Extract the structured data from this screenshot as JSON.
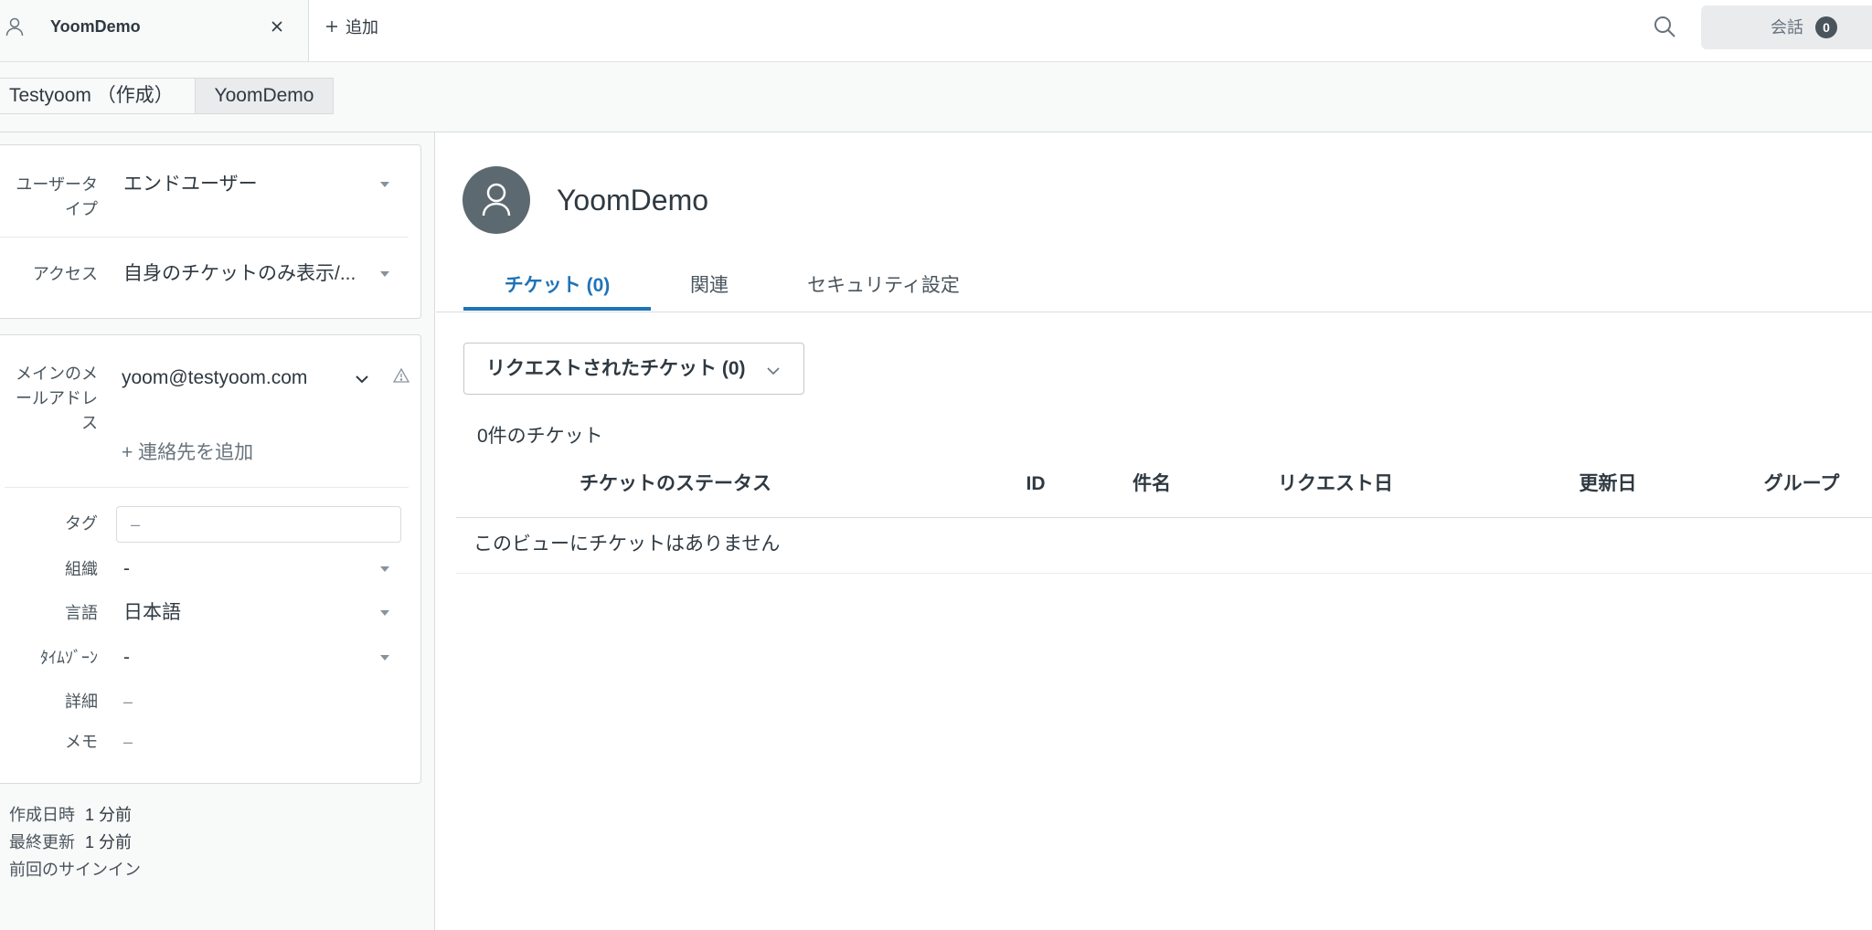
{
  "topbar": {
    "tab_label": "YoomDemo",
    "add_label": "追加",
    "conversations_label": "会話",
    "conversations_count": "0",
    "icons": {
      "tab": "person-icon",
      "close": "close-icon",
      "add": "plus-icon",
      "search": "search-icon"
    }
  },
  "breadcrumb": {
    "items": [
      {
        "label": "Testyoom （作成）",
        "selected": false
      },
      {
        "label": "YoomDemo",
        "selected": true
      }
    ]
  },
  "user_panel": {
    "user_type": {
      "label": "ユーザータイプ",
      "value": "エンドユーザー"
    },
    "access": {
      "label": "アクセス",
      "value": "自身のチケットのみ表示/..."
    },
    "email": {
      "label": "メインのメールアドレス",
      "value": "yoom@testyoom.com"
    },
    "add_contact": "+ 連絡先を追加",
    "tags": {
      "label": "タグ",
      "placeholder": "–"
    },
    "organization": {
      "label": "組織",
      "value": "-"
    },
    "language": {
      "label": "言語",
      "value": "日本語"
    },
    "timezone": {
      "label": "ﾀｲﾑｿﾞｰﾝ",
      "value": "-"
    },
    "details": {
      "label": "詳細",
      "value": "–"
    },
    "notes": {
      "label": "メモ",
      "value": "–"
    }
  },
  "meta": [
    {
      "label": "作成日時",
      "value": "1 分前"
    },
    {
      "label": "最終更新",
      "value": "1 分前"
    },
    {
      "label": "前回のサインイン"
    }
  ],
  "main": {
    "title": "YoomDemo",
    "tabs": [
      {
        "label": "チケット (0)",
        "active": true
      },
      {
        "label": "関連",
        "active": false
      },
      {
        "label": "セキュリティ設定",
        "active": false
      }
    ],
    "view_select": "リクエストされたチケット (0)",
    "ticket_count": "0件のチケット",
    "columns": [
      "チケットのステータス",
      "ID",
      "件名",
      "リクエスト日",
      "更新日",
      "グループ"
    ],
    "empty_message": "このビューにチケットはありません"
  },
  "theme": {
    "accent": "#1f73b7",
    "avatar_bg": "#5c6970"
  }
}
